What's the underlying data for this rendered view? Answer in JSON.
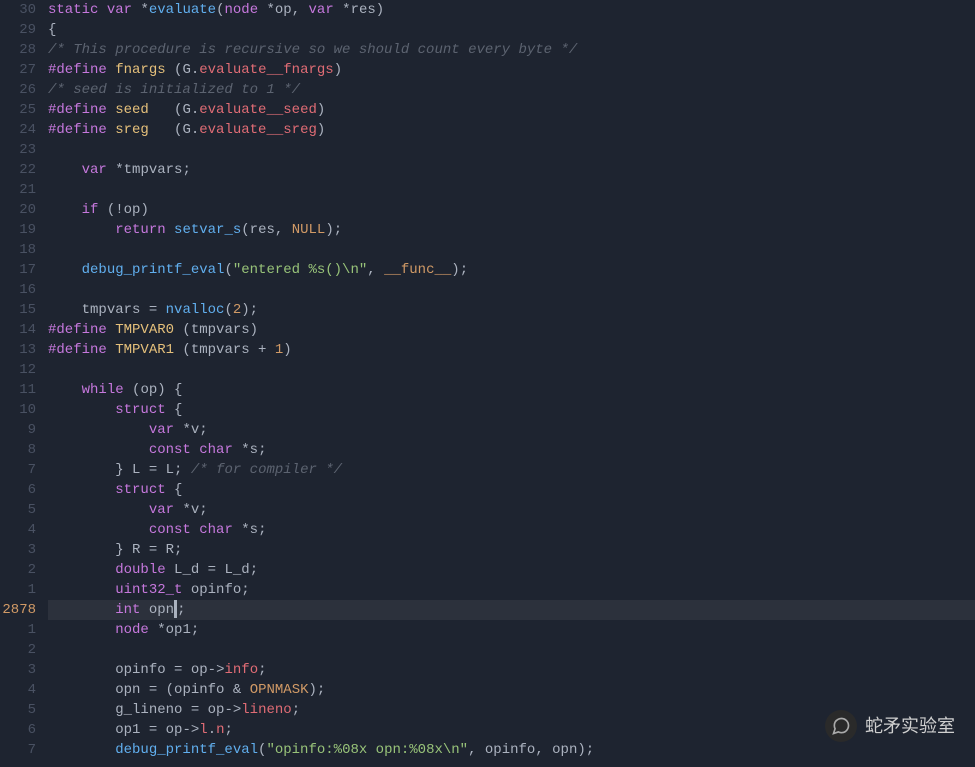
{
  "current_line_number": "2878",
  "gutter": [
    "30",
    "29",
    "28",
    "27",
    "26",
    "25",
    "24",
    "23",
    "22",
    "21",
    "20",
    "19",
    "18",
    "17",
    "16",
    "15",
    "14",
    "13",
    "12",
    "11",
    "10",
    "9",
    "8",
    "7",
    "6",
    "5",
    "4",
    "3",
    "2",
    "1",
    "2878",
    "1",
    "2",
    "3",
    "4",
    "5",
    "6",
    "7"
  ],
  "lines": [
    {
      "i": 0,
      "tokens": [
        {
          "t": "static",
          "c": "kw"
        },
        {
          "t": " "
        },
        {
          "t": "var",
          "c": "type"
        },
        {
          "t": " *"
        },
        {
          "t": "evaluate",
          "c": "fn"
        },
        {
          "t": "("
        },
        {
          "t": "node",
          "c": "type"
        },
        {
          "t": " *"
        },
        {
          "t": "op",
          "c": "ident"
        },
        {
          "t": ", "
        },
        {
          "t": "var",
          "c": "type"
        },
        {
          "t": " *"
        },
        {
          "t": "res",
          "c": "ident"
        },
        {
          "t": ")"
        }
      ]
    },
    {
      "i": 1,
      "tokens": [
        {
          "t": "{"
        }
      ]
    },
    {
      "i": 2,
      "tokens": [
        {
          "t": "/* This procedure is recursive so we should count every byte */",
          "c": "com"
        }
      ]
    },
    {
      "i": 3,
      "tokens": [
        {
          "t": "#define",
          "c": "def"
        },
        {
          "t": " "
        },
        {
          "t": "fnargs",
          "c": "macro"
        },
        {
          "t": " ("
        },
        {
          "t": "G",
          "c": "ident"
        },
        {
          "t": "."
        },
        {
          "t": "evaluate__fnargs",
          "c": "field"
        },
        {
          "t": ")"
        }
      ]
    },
    {
      "i": 4,
      "tokens": [
        {
          "t": "/* seed is initialized to 1 */",
          "c": "com"
        }
      ]
    },
    {
      "i": 5,
      "tokens": [
        {
          "t": "#define",
          "c": "def"
        },
        {
          "t": " "
        },
        {
          "t": "seed",
          "c": "macro"
        },
        {
          "t": "   ("
        },
        {
          "t": "G",
          "c": "ident"
        },
        {
          "t": "."
        },
        {
          "t": "evaluate__seed",
          "c": "field"
        },
        {
          "t": ")"
        }
      ]
    },
    {
      "i": 6,
      "tokens": [
        {
          "t": "#define",
          "c": "def"
        },
        {
          "t": " "
        },
        {
          "t": "sreg",
          "c": "macro"
        },
        {
          "t": "   ("
        },
        {
          "t": "G",
          "c": "ident"
        },
        {
          "t": "."
        },
        {
          "t": "evaluate__sreg",
          "c": "field"
        },
        {
          "t": ")"
        }
      ]
    },
    {
      "i": 7,
      "tokens": []
    },
    {
      "i": 8,
      "tokens": [
        {
          "t": "    "
        },
        {
          "t": "var",
          "c": "type"
        },
        {
          "t": " *"
        },
        {
          "t": "tmpvars",
          "c": "ident"
        },
        {
          "t": ";"
        }
      ]
    },
    {
      "i": 9,
      "tokens": []
    },
    {
      "i": 10,
      "tokens": [
        {
          "t": "    "
        },
        {
          "t": "if",
          "c": "kw"
        },
        {
          "t": " (!"
        },
        {
          "t": "op",
          "c": "ident"
        },
        {
          "t": ")"
        }
      ]
    },
    {
      "i": 11,
      "tokens": [
        {
          "t": "        "
        },
        {
          "t": "return",
          "c": "kw"
        },
        {
          "t": " "
        },
        {
          "t": "setvar_s",
          "c": "fn"
        },
        {
          "t": "("
        },
        {
          "t": "res",
          "c": "ident"
        },
        {
          "t": ", "
        },
        {
          "t": "NULL",
          "c": "const"
        },
        {
          "t": ");"
        }
      ]
    },
    {
      "i": 12,
      "tokens": []
    },
    {
      "i": 13,
      "tokens": [
        {
          "t": "    "
        },
        {
          "t": "debug_printf_eval",
          "c": "fn"
        },
        {
          "t": "("
        },
        {
          "t": "\"entered %s()\\n\"",
          "c": "str"
        },
        {
          "t": ", "
        },
        {
          "t": "__func__",
          "c": "const"
        },
        {
          "t": ");"
        }
      ]
    },
    {
      "i": 14,
      "tokens": []
    },
    {
      "i": 15,
      "tokens": [
        {
          "t": "    "
        },
        {
          "t": "tmpvars",
          "c": "ident"
        },
        {
          "t": " = "
        },
        {
          "t": "nvalloc",
          "c": "fn"
        },
        {
          "t": "("
        },
        {
          "t": "2",
          "c": "num"
        },
        {
          "t": ");"
        }
      ]
    },
    {
      "i": 16,
      "tokens": [
        {
          "t": "#define",
          "c": "def"
        },
        {
          "t": " "
        },
        {
          "t": "TMPVAR0",
          "c": "macro"
        },
        {
          "t": " ("
        },
        {
          "t": "tmpvars",
          "c": "ident"
        },
        {
          "t": ")"
        }
      ]
    },
    {
      "i": 17,
      "tokens": [
        {
          "t": "#define",
          "c": "def"
        },
        {
          "t": " "
        },
        {
          "t": "TMPVAR1",
          "c": "macro"
        },
        {
          "t": " ("
        },
        {
          "t": "tmpvars",
          "c": "ident"
        },
        {
          "t": " + "
        },
        {
          "t": "1",
          "c": "num"
        },
        {
          "t": ")"
        }
      ]
    },
    {
      "i": 18,
      "tokens": []
    },
    {
      "i": 19,
      "tokens": [
        {
          "t": "    "
        },
        {
          "t": "while",
          "c": "kw"
        },
        {
          "t": " ("
        },
        {
          "t": "op",
          "c": "ident"
        },
        {
          "t": ") {"
        }
      ]
    },
    {
      "i": 20,
      "tokens": [
        {
          "t": "        "
        },
        {
          "t": "struct",
          "c": "kw"
        },
        {
          "t": " {"
        }
      ]
    },
    {
      "i": 21,
      "tokens": [
        {
          "t": "            "
        },
        {
          "t": "var",
          "c": "type"
        },
        {
          "t": " *"
        },
        {
          "t": "v",
          "c": "ident"
        },
        {
          "t": ";"
        }
      ]
    },
    {
      "i": 22,
      "tokens": [
        {
          "t": "            "
        },
        {
          "t": "const",
          "c": "kw"
        },
        {
          "t": " "
        },
        {
          "t": "char",
          "c": "type"
        },
        {
          "t": " *"
        },
        {
          "t": "s",
          "c": "ident"
        },
        {
          "t": ";"
        }
      ]
    },
    {
      "i": 23,
      "tokens": [
        {
          "t": "        } "
        },
        {
          "t": "L",
          "c": "ident"
        },
        {
          "t": " = "
        },
        {
          "t": "L",
          "c": "ident"
        },
        {
          "t": "; "
        },
        {
          "t": "/* for compiler */",
          "c": "com"
        }
      ]
    },
    {
      "i": 24,
      "tokens": [
        {
          "t": "        "
        },
        {
          "t": "struct",
          "c": "kw"
        },
        {
          "t": " {"
        }
      ]
    },
    {
      "i": 25,
      "tokens": [
        {
          "t": "            "
        },
        {
          "t": "var",
          "c": "type"
        },
        {
          "t": " *"
        },
        {
          "t": "v",
          "c": "ident"
        },
        {
          "t": ";"
        }
      ]
    },
    {
      "i": 26,
      "tokens": [
        {
          "t": "            "
        },
        {
          "t": "const",
          "c": "kw"
        },
        {
          "t": " "
        },
        {
          "t": "char",
          "c": "type"
        },
        {
          "t": " *"
        },
        {
          "t": "s",
          "c": "ident"
        },
        {
          "t": ";"
        }
      ]
    },
    {
      "i": 27,
      "tokens": [
        {
          "t": "        } "
        },
        {
          "t": "R",
          "c": "ident"
        },
        {
          "t": " = "
        },
        {
          "t": "R",
          "c": "ident"
        },
        {
          "t": ";"
        }
      ]
    },
    {
      "i": 28,
      "tokens": [
        {
          "t": "        "
        },
        {
          "t": "double",
          "c": "type"
        },
        {
          "t": " "
        },
        {
          "t": "L_d",
          "c": "ident"
        },
        {
          "t": " = "
        },
        {
          "t": "L_d",
          "c": "ident"
        },
        {
          "t": ";"
        }
      ]
    },
    {
      "i": 29,
      "tokens": [
        {
          "t": "        "
        },
        {
          "t": "uint32_t",
          "c": "type"
        },
        {
          "t": " "
        },
        {
          "t": "opinfo",
          "c": "ident"
        },
        {
          "t": ";"
        }
      ]
    },
    {
      "i": 30,
      "cursor": true,
      "tokens": [
        {
          "t": "        "
        },
        {
          "t": "int",
          "c": "type"
        },
        {
          "t": " "
        },
        {
          "t": "opn",
          "c": "ident"
        },
        {
          "t": ";",
          "cursorBefore": true
        }
      ]
    },
    {
      "i": 31,
      "tokens": [
        {
          "t": "        "
        },
        {
          "t": "node",
          "c": "type"
        },
        {
          "t": " *"
        },
        {
          "t": "op1",
          "c": "ident"
        },
        {
          "t": ";"
        }
      ]
    },
    {
      "i": 32,
      "tokens": []
    },
    {
      "i": 33,
      "tokens": [
        {
          "t": "        "
        },
        {
          "t": "opinfo",
          "c": "ident"
        },
        {
          "t": " = "
        },
        {
          "t": "op",
          "c": "ident"
        },
        {
          "t": "->"
        },
        {
          "t": "info",
          "c": "field"
        },
        {
          "t": ";"
        }
      ]
    },
    {
      "i": 34,
      "tokens": [
        {
          "t": "        "
        },
        {
          "t": "opn",
          "c": "ident"
        },
        {
          "t": " = ("
        },
        {
          "t": "opinfo",
          "c": "ident"
        },
        {
          "t": " & "
        },
        {
          "t": "OPNMASK",
          "c": "const"
        },
        {
          "t": ");"
        }
      ]
    },
    {
      "i": 35,
      "tokens": [
        {
          "t": "        "
        },
        {
          "t": "g_lineno",
          "c": "ident"
        },
        {
          "t": " = "
        },
        {
          "t": "op",
          "c": "ident"
        },
        {
          "t": "->"
        },
        {
          "t": "lineno",
          "c": "field"
        },
        {
          "t": ";"
        }
      ]
    },
    {
      "i": 36,
      "tokens": [
        {
          "t": "        "
        },
        {
          "t": "op1",
          "c": "ident"
        },
        {
          "t": " = "
        },
        {
          "t": "op",
          "c": "ident"
        },
        {
          "t": "->"
        },
        {
          "t": "l",
          "c": "field"
        },
        {
          "t": "."
        },
        {
          "t": "n",
          "c": "field"
        },
        {
          "t": ";"
        }
      ]
    },
    {
      "i": 37,
      "tokens": [
        {
          "t": "        "
        },
        {
          "t": "debug_printf_eval",
          "c": "fn"
        },
        {
          "t": "("
        },
        {
          "t": "\"opinfo:%08x opn:%08x\\n\"",
          "c": "str"
        },
        {
          "t": ", "
        },
        {
          "t": "opinfo",
          "c": "ident"
        },
        {
          "t": ", "
        },
        {
          "t": "opn",
          "c": "ident"
        },
        {
          "t": ");"
        }
      ]
    }
  ],
  "watermark": {
    "text": "蛇矛实验室"
  }
}
